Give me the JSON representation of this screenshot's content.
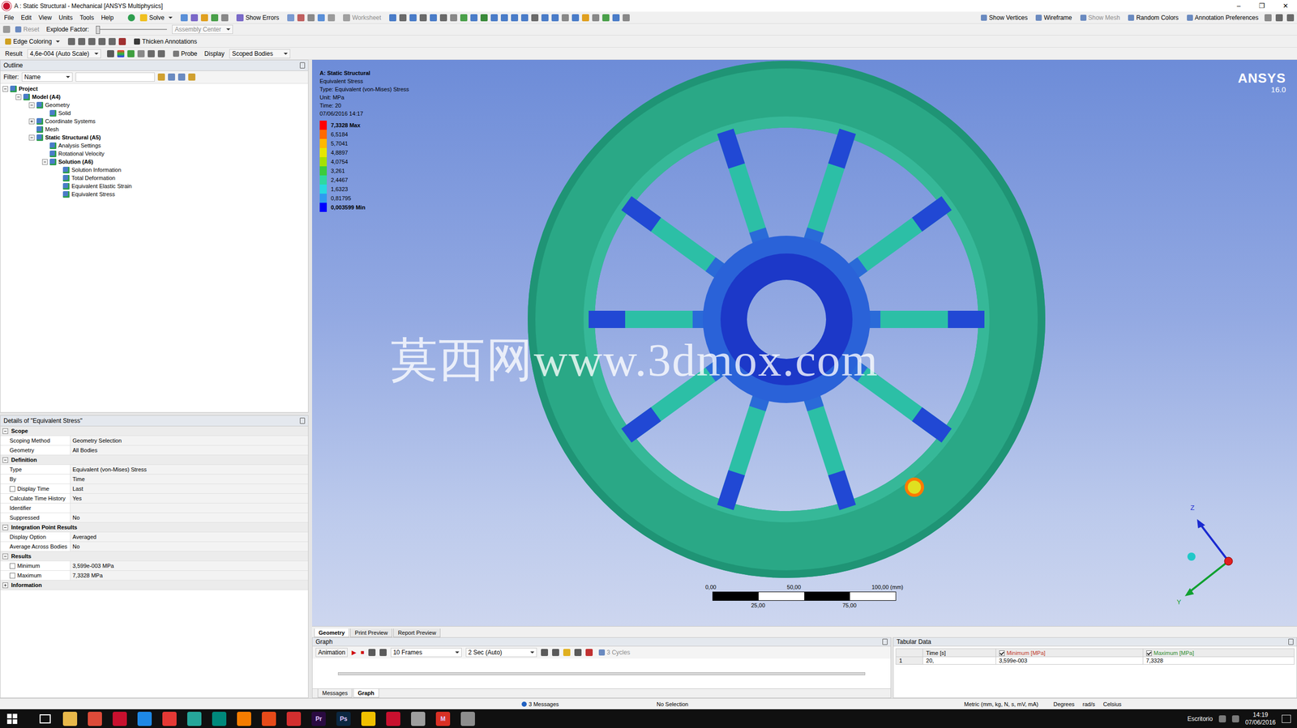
{
  "window": {
    "title": "A : Static Structural - Mechanical [ANSYS Multiphysics]",
    "controls": [
      "–",
      "❐",
      "✕"
    ]
  },
  "menu": [
    "File",
    "Edit",
    "View",
    "Units",
    "Tools",
    "Help"
  ],
  "toolbar": {
    "main": [
      {
        "label": "Solve",
        "disabled": false,
        "dropdown": true
      },
      {
        "label": "Show Errors",
        "disabled": false,
        "dropdown": false
      },
      {
        "label": "Worksheet",
        "disabled": true,
        "dropdown": false
      }
    ],
    "view": [
      {
        "label": "Show Vertices",
        "disabled": false
      },
      {
        "label": "Wireframe",
        "disabled": false
      },
      {
        "label": "Show Mesh",
        "disabled": true
      },
      {
        "label": "Random Colors",
        "disabled": false
      },
      {
        "label": "Annotation Preferences",
        "disabled": false
      }
    ],
    "explode": {
      "reset": "Reset",
      "reset_disabled": true,
      "label": "Explode Factor:",
      "level": 0,
      "assembly": "Assembly Center",
      "assembly_disabled": true
    },
    "annotation": {
      "edge_coloring": "Edge Coloring",
      "thicken": "Thicken Annotations"
    },
    "result": {
      "label": "Result",
      "scale": "4,6e-004 (Auto Scale)",
      "probe": "Probe",
      "display": "Display",
      "scope": "Scoped Bodies"
    }
  },
  "outline": {
    "title": "Outline",
    "filter_label": "Filter:",
    "filter_field": "Name",
    "search": "",
    "tree": [
      {
        "label": "Project",
        "depth": 0,
        "kind": "branch",
        "expanded": true
      },
      {
        "label": "Model (A4)",
        "depth": 1,
        "kind": "branch",
        "expanded": true
      },
      {
        "label": "Geometry",
        "depth": 2,
        "kind": "branch",
        "expanded": true
      },
      {
        "label": "Solid",
        "depth": 3,
        "kind": "leaf",
        "expanded": false
      },
      {
        "label": "Coordinate Systems",
        "depth": 2,
        "kind": "branch",
        "expanded": false
      },
      {
        "label": "Mesh",
        "depth": 2,
        "kind": "leaf",
        "expanded": false
      },
      {
        "label": "Static Structural (A5)",
        "depth": 2,
        "kind": "branch",
        "expanded": true
      },
      {
        "label": "Analysis Settings",
        "depth": 3,
        "kind": "leaf",
        "expanded": false
      },
      {
        "label": "Rotational Velocity",
        "depth": 3,
        "kind": "leaf",
        "expanded": false
      },
      {
        "label": "Solution (A6)",
        "depth": 3,
        "kind": "branch",
        "expanded": true
      },
      {
        "label": "Solution Information",
        "depth": 4,
        "kind": "leaf",
        "expanded": false
      },
      {
        "label": "Total Deformation",
        "depth": 4,
        "kind": "leaf",
        "expanded": false
      },
      {
        "label": "Equivalent Elastic Strain",
        "depth": 4,
        "kind": "leaf",
        "expanded": false
      },
      {
        "label": "Equivalent Stress",
        "depth": 4,
        "kind": "leaf",
        "expanded": false
      }
    ]
  },
  "details": {
    "title": "Details of \"Equivalent Stress\"",
    "rows": [
      {
        "kind": "group",
        "label": "Scope",
        "value": "",
        "expanded": true,
        "checked": false
      },
      {
        "kind": "field",
        "label": "Scoping Method",
        "value": "Geometry Selection",
        "expanded": false,
        "checked": false
      },
      {
        "kind": "field",
        "label": "Geometry",
        "value": "All Bodies",
        "expanded": false,
        "checked": false
      },
      {
        "kind": "group",
        "label": "Definition",
        "value": "",
        "expanded": true,
        "checked": false
      },
      {
        "kind": "field",
        "label": "Type",
        "value": "Equivalent (von-Mises) Stress",
        "expanded": false,
        "checked": false
      },
      {
        "kind": "field",
        "label": "By",
        "value": "Time",
        "expanded": false,
        "checked": false
      },
      {
        "kind": "check-field",
        "label": "Display Time",
        "value": "Last",
        "expanded": false,
        "checked": false
      },
      {
        "kind": "field",
        "label": "Calculate Time History",
        "value": "Yes",
        "expanded": false,
        "checked": false
      },
      {
        "kind": "field",
        "label": "Identifier",
        "value": "",
        "expanded": false,
        "checked": false
      },
      {
        "kind": "field",
        "label": "Suppressed",
        "value": "No",
        "expanded": false,
        "checked": false
      },
      {
        "kind": "group",
        "label": "Integration Point Results",
        "value": "",
        "expanded": true,
        "checked": false
      },
      {
        "kind": "field",
        "label": "Display Option",
        "value": "Averaged",
        "expanded": false,
        "checked": false
      },
      {
        "kind": "field",
        "label": "Average Across Bodies",
        "value": "No",
        "expanded": false,
        "checked": false
      },
      {
        "kind": "group",
        "label": "Results",
        "value": "",
        "expanded": true,
        "checked": false
      },
      {
        "kind": "check-field",
        "label": "Minimum",
        "value": "3,599e-003 MPa",
        "expanded": false,
        "checked": false
      },
      {
        "kind": "check-field",
        "label": "Maximum",
        "value": "7,3328 MPa",
        "expanded": false,
        "checked": false
      },
      {
        "kind": "group",
        "label": "Information",
        "value": "",
        "expanded": false,
        "checked": false
      }
    ]
  },
  "viewport": {
    "legend": {
      "title": "A: Static Structural",
      "lines": [
        "Equivalent Stress",
        "Type: Equivalent (von-Mises) Stress",
        "Unit: MPa",
        "Time: 20",
        "07/06/2016 14:17"
      ],
      "bands": [
        {
          "label": "7,3328 Max",
          "emphasis": true,
          "color": "#ff0000"
        },
        {
          "label": "6,5184",
          "emphasis": false,
          "color": "#ff6a00"
        },
        {
          "label": "5,7041",
          "emphasis": false,
          "color": "#ffb800"
        },
        {
          "label": "4,8897",
          "emphasis": false,
          "color": "#e6e600"
        },
        {
          "label": "4,0754",
          "emphasis": false,
          "color": "#a6e000"
        },
        {
          "label": "3,261",
          "emphasis": false,
          "color": "#3ccc3c"
        },
        {
          "label": "2,4467",
          "emphasis": false,
          "color": "#2fd8a0"
        },
        {
          "label": "1,6323",
          "emphasis": false,
          "color": "#28d8e0"
        },
        {
          "label": "0,81795",
          "emphasis": false,
          "color": "#2f9af0"
        },
        {
          "label": "0,003599 Min",
          "emphasis": true,
          "color": "#0000ff"
        }
      ]
    },
    "logo": {
      "name": "ANSYS",
      "version": "16.0"
    },
    "watermark": "莫西网www.3dmox.com",
    "scale": {
      "top": [
        "0,00",
        "50,00",
        "100,00 (mm)"
      ],
      "bottom": [
        "25,00",
        "75,00"
      ]
    },
    "triad": {
      "z": "Z",
      "y": "Y"
    },
    "tabs": [
      {
        "label": "Geometry",
        "selected": true
      },
      {
        "label": "Print Preview",
        "selected": false
      },
      {
        "label": "Report Preview",
        "selected": false
      }
    ]
  },
  "graph": {
    "title": "Graph",
    "animation": "Animation",
    "play": "▶",
    "stop": "■",
    "frames": "10 Frames",
    "duration": "2 Sec (Auto)",
    "cycles": "3 Cycles",
    "cycles_disabled": true,
    "tabs": [
      {
        "label": "Messages",
        "selected": false
      },
      {
        "label": "Graph",
        "selected": true
      }
    ]
  },
  "tabular": {
    "title": "Tabular Data",
    "columns": [
      {
        "label": "Time [s]",
        "checkbox": false,
        "checked": false,
        "color": "#000000"
      },
      {
        "label": "Minimum [MPa]",
        "checkbox": true,
        "checked": true,
        "color": "#c0392b"
      },
      {
        "label": "Maximum [MPa]",
        "checkbox": true,
        "checked": true,
        "color": "#2e8b2e"
      }
    ],
    "rows": [
      {
        "index": "1",
        "cells": [
          "20,",
          "3,599e-003",
          "7,3328"
        ]
      }
    ]
  },
  "status": {
    "messages": "3 Messages",
    "selection": "No Selection",
    "units": "Metric (mm, kg, N, s, mV, mA)",
    "angle": "Degrees",
    "rotation": "rad/s",
    "temperature": "Celsius"
  },
  "taskbar": {
    "apps": [
      {
        "label": "",
        "color": "#e8b84a"
      },
      {
        "label": "",
        "color": "#dd4b39"
      },
      {
        "label": "",
        "color": "#c8102e"
      },
      {
        "label": "",
        "color": "#1e88e5"
      },
      {
        "label": "",
        "color": "#e53935"
      },
      {
        "label": "",
        "color": "#26a69a"
      },
      {
        "label": "",
        "color": "#00897b"
      },
      {
        "label": "",
        "color": "#f57c00"
      },
      {
        "label": "",
        "color": "#e64a19"
      },
      {
        "label": "",
        "color": "#d32f2f"
      },
      {
        "label": "Pr",
        "color": "#2a0a40"
      },
      {
        "label": "Ps",
        "color": "#0b2740"
      },
      {
        "label": "",
        "color": "#f0c000"
      },
      {
        "label": "",
        "color": "#c8102e"
      },
      {
        "label": "",
        "color": "#9e9e9e"
      },
      {
        "label": "M",
        "color": "#d93025"
      },
      {
        "label": "",
        "color": "#8d8d8d"
      }
    ],
    "desktop": "Escritorio",
    "time": "14:19",
    "date": "07/06/2016"
  }
}
